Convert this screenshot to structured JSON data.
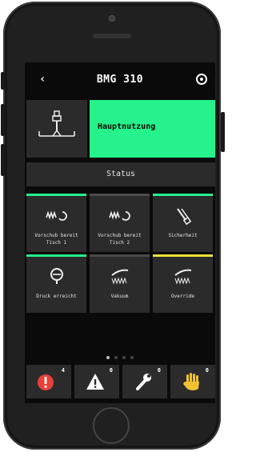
{
  "header": {
    "back_label": "‹",
    "title": "BMG 310"
  },
  "mode": {
    "label": "Hauptnutzung",
    "active_color": "#25f28a"
  },
  "status": {
    "label": "Status"
  },
  "tiles": [
    {
      "label": "Vorschub bereit\nTisch 1",
      "icon": "feed-icon",
      "bar_color": "#25f28a"
    },
    {
      "label": "Vorschub bereit\nTisch 2",
      "icon": "feed-icon",
      "bar_color": "#4a4a4a"
    },
    {
      "label": "Sicherheit",
      "icon": "safety-tools-icon",
      "bar_color": "#25f28a"
    },
    {
      "label": "Druck erreicht",
      "icon": "pressure-gauge-icon",
      "bar_color": "#25f28a"
    },
    {
      "label": "Vakuum",
      "icon": "vacuum-icon",
      "bar_color": "#4a4a4a"
    },
    {
      "label": "Override",
      "icon": "override-icon",
      "bar_color": "#f2e03a"
    }
  ],
  "pager": {
    "count": 4,
    "active": 0
  },
  "alarms": [
    {
      "name": "error",
      "icon": "error-icon",
      "count": "4",
      "color": "#e8413a"
    },
    {
      "name": "warning",
      "icon": "warning-icon",
      "count": "0",
      "color": "#ffffff"
    },
    {
      "name": "service",
      "icon": "wrench-icon",
      "count": "0",
      "color": "#ffffff"
    },
    {
      "name": "manual",
      "icon": "hand-icon",
      "count": "0",
      "color": "#f2c230"
    }
  ]
}
